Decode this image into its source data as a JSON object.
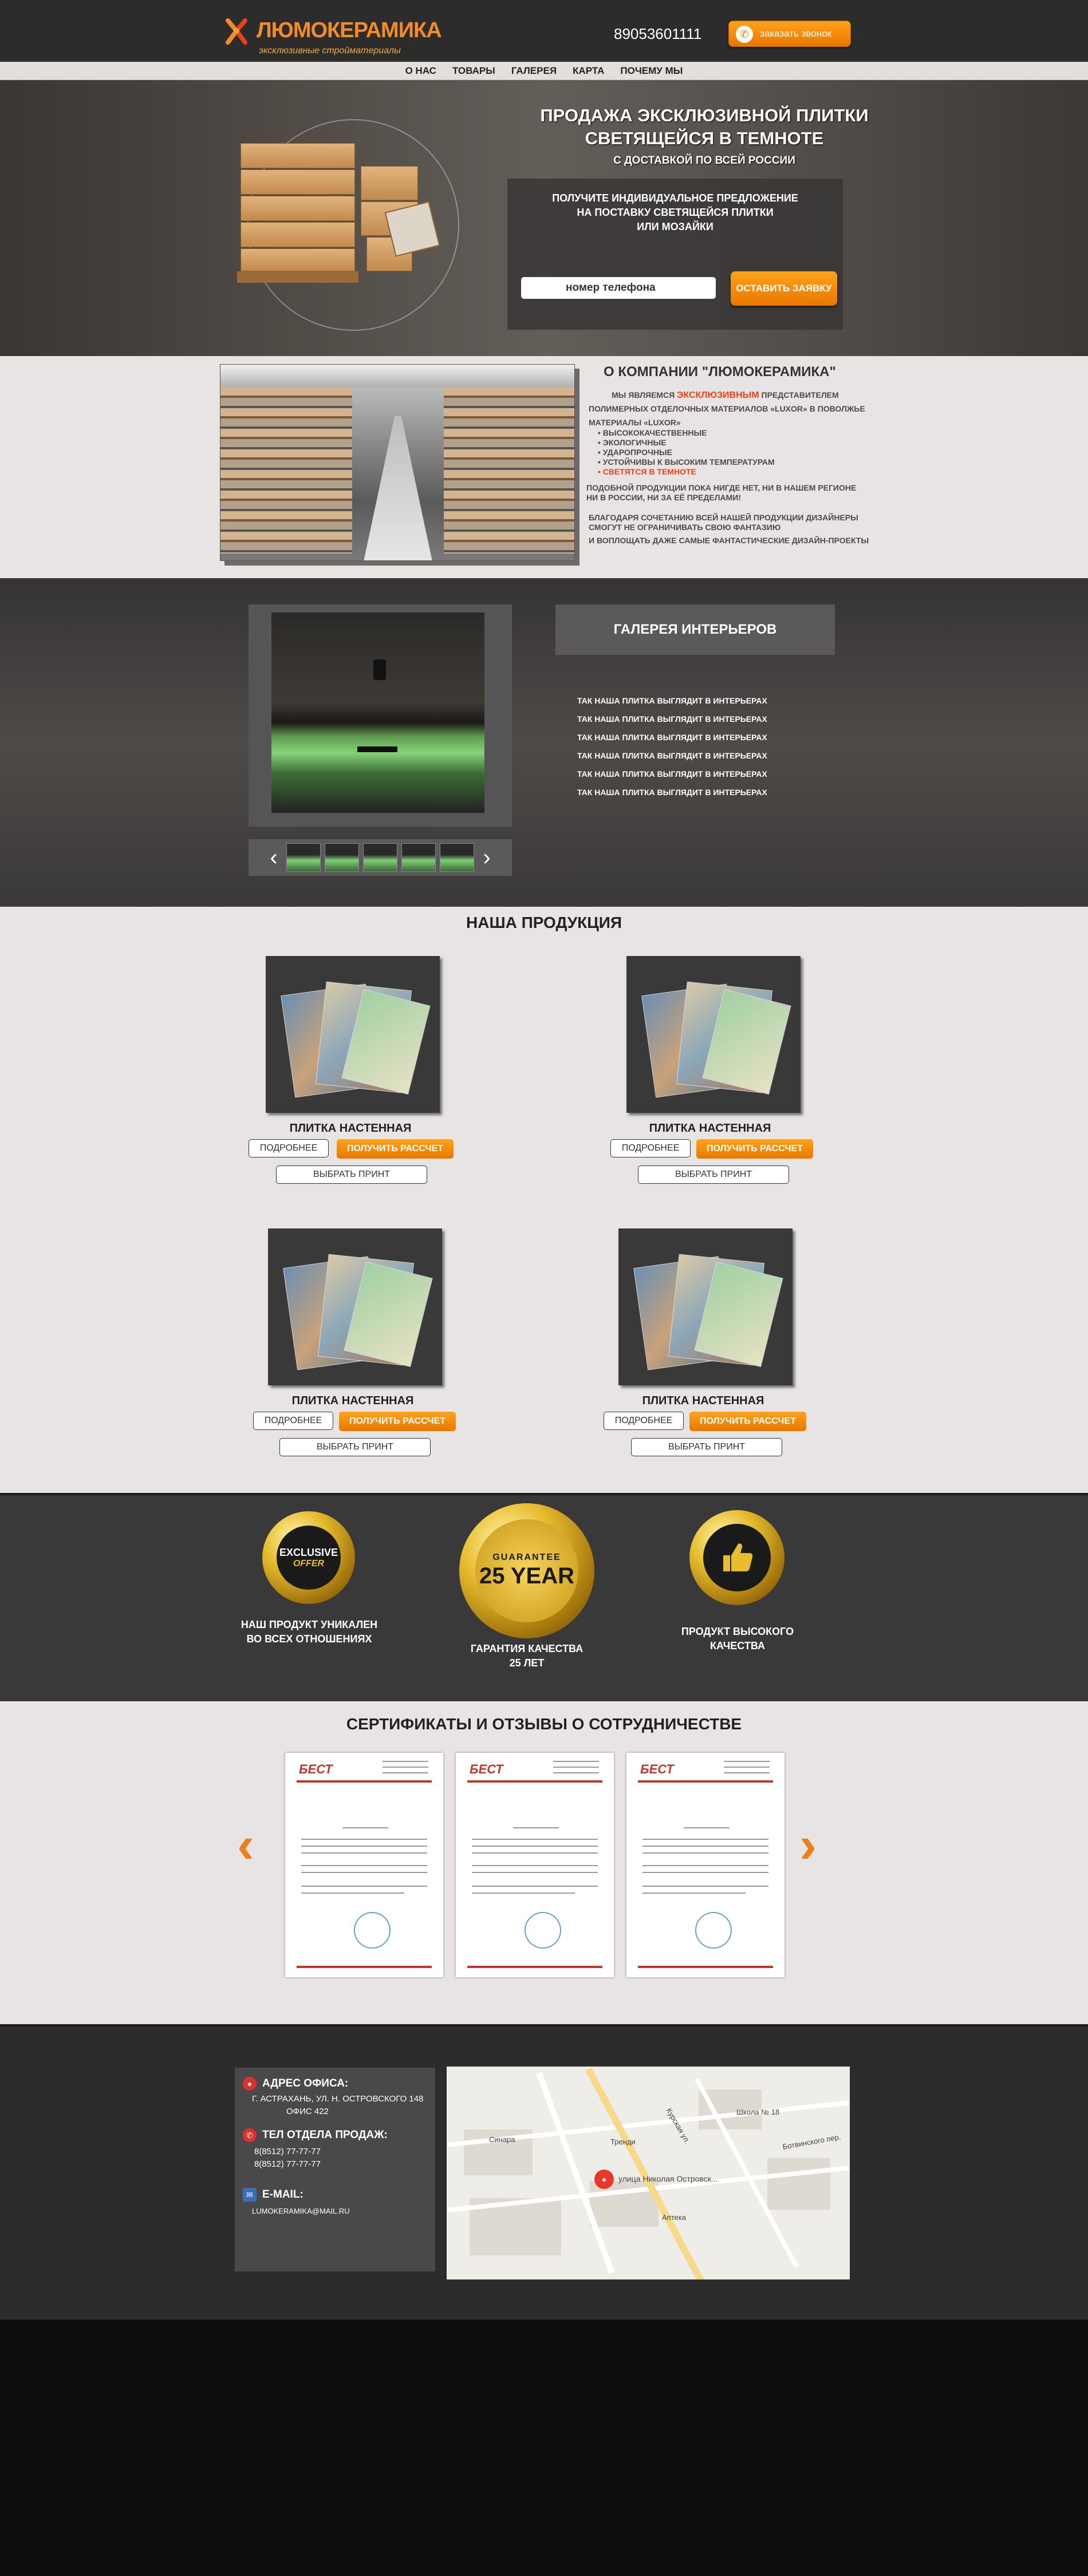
{
  "header": {
    "logo_title": "ЛЮМОКЕРАМИКА",
    "logo_subtitle": "эксклюзивные стройматериалы",
    "phone": "89053601111",
    "callback_label": "заказать звонок"
  },
  "nav": {
    "items": [
      {
        "label": "О НАС"
      },
      {
        "label": "ТОВАРЫ"
      },
      {
        "label": "ГАЛЕРЕЯ"
      },
      {
        "label": "КАРТА"
      },
      {
        "label": "ПОЧЕМУ МЫ"
      }
    ]
  },
  "hero": {
    "title_line1": "ПРОДАЖА ЭКСКЛЮЗИВНОЙ ПЛИТКИ",
    "title_line2": "СВЕТЯЩЕЙСЯ В ТЕМНОТЕ",
    "subtitle": "С ДОСТАВКОЙ ПО ВСЕЙ РОССИИ",
    "offer_line1": "ПОЛУЧИТЕ ИНДИВИДУАЛЬНОЕ ПРЕДЛОЖЕНИЕ",
    "offer_line2": "НА ПОСТАВКУ СВЕТЯЩЕЙСЯ ПЛИТКИ",
    "offer_line3": "ИЛИ МОЗАЙКИ",
    "phone_placeholder": "номер телефона",
    "order_label": "ОСТАВИТЬ ЗАЯВКУ"
  },
  "about": {
    "title": "О КОМПАНИИ \"ЛЮМОКЕРАМИКА\"",
    "intro_before": "МЫ ЯВЛЯЕМСЯ ",
    "intro_highlight": "ЭКСКЛЮЗИВНЫМ",
    "intro_after": " ПРЕДСТАВИТЕЛЕМ",
    "line2": "ПОЛИМЕРНЫХ ОТДЕЛОЧНЫХ МАТЕРИАЛОВ «LUXOR» В ПОВОЛЖЬЕ",
    "materials_head": "МАТЕРИАЛЫ «LUXOR»",
    "features": [
      "• ВЫСОКОКАЧЕСТВЕННЫЕ",
      "• ЭКОЛОГИЧНЫЕ",
      "• УДАРОПРОЧНЫЕ",
      "• УСТОЙЧИВЫ К ВЫСОКИМ ТЕМПЕРАТУРАМ"
    ],
    "feature_highlight": "• СВЕТЯТСЯ В ТЕМНОТЕ",
    "para1_l1": "ПОДОБНОЙ ПРОДУКЦИИ ПОКА НИГДЕ НЕТ, НИ В НАШЕМ РЕГИОНЕ",
    "para1_l2": "НИ В РОССИИ, НИ ЗА ЕЁ ПРЕДЕЛАМИ!",
    "para2_l1": "БЛАГОДАРЯ СОЧЕТАНИЮ ВСЕЙ НАШЕЙ ПРОДУКЦИИ ДИЗАЙНЕРЫ",
    "para2_l2": "СМОГУТ НЕ ОГРАНИЧИВАТЬ СВОЮ ФАНТАЗИЮ",
    "para2_l3": "И ВОПЛОЩАТЬ ДАЖЕ САМЫЕ ФАНТАСТИЧЕСКИЕ ДИЗАЙН-ПРОЕКТЫ"
  },
  "gallery": {
    "title": "ГАЛЕРЕЯ ИНТЕРЬЕРОВ",
    "lines": [
      "ТАК НАША ПЛИТКА ВЫГЛЯДИТ В ИНТЕРЬЕРАХ",
      "ТАК НАША ПЛИТКА ВЫГЛЯДИТ В ИНТЕРЬЕРАХ",
      "ТАК НАША ПЛИТКА ВЫГЛЯДИТ В ИНТЕРЬЕРАХ",
      "ТАК НАША ПЛИТКА ВЫГЛЯДИТ В ИНТЕРЬЕРАХ",
      "ТАК НАША ПЛИТКА ВЫГЛЯДИТ В ИНТЕРЬЕРАХ",
      "ТАК НАША ПЛИТКА ВЫГЛЯДИТ В ИНТЕРЬЕРАХ"
    ],
    "prev_icon": "chevron-left-icon",
    "next_icon": "chevron-right-icon"
  },
  "products": {
    "title": "НАША ПРОДУКЦИЯ",
    "items": [
      {
        "name": "ПЛИТКА НАСТЕННАЯ",
        "details_label": "ПОДРОБНЕЕ",
        "calc_label": "ПОЛУЧИТЬ РАССЧЕТ",
        "print_label": "ВЫБРАТЬ ПРИНТ"
      },
      {
        "name": "ПЛИТКА НАСТЕННАЯ",
        "details_label": "ПОДРОБНЕЕ",
        "calc_label": "ПОЛУЧИТЬ РАССЧЕТ",
        "print_label": "ВЫБРАТЬ ПРИНТ"
      },
      {
        "name": "ПЛИТКА НАСТЕННАЯ",
        "details_label": "ПОДРОБНЕЕ",
        "calc_label": "ПОЛУЧИТЬ РАССЧЕТ",
        "print_label": "ВЫБРАТЬ ПРИНТ"
      },
      {
        "name": "ПЛИТКА НАСТЕННАЯ",
        "details_label": "ПОДРОБНЕЕ",
        "calc_label": "ПОЛУЧИТЬ РАССЧЕТ",
        "print_label": "ВЫБРАТЬ ПРИНТ"
      }
    ]
  },
  "badges": {
    "items": [
      {
        "seal_line1": "EXCLUSIVE",
        "seal_line2": "OFFER",
        "caption_line1": "НАШ ПРОДУКТ УНИКАЛЕН",
        "caption_line2": "ВО ВСЕХ ОТНОШЕНИЯХ"
      },
      {
        "seal_line1": "GUARANTEE",
        "seal_line2": "25 YEAR",
        "caption_line1": "ГАРАНТИЯ КАЧЕСТВА",
        "caption_line2": "25 ЛЕТ"
      },
      {
        "seal_icon": "thumbs-up-icon",
        "caption_line1": "ПРОДУКТ ВЫСОКОГО",
        "caption_line2": "КАЧЕСТВА"
      }
    ]
  },
  "certificates": {
    "title": "СЕРТИФИКАТЫ И ОТЗЫВЫ О СОТРУДНИЧЕСТВЕ",
    "items": [
      {
        "logo": "БЕСТ"
      },
      {
        "logo": "БЕСТ"
      },
      {
        "logo": "БЕСТ"
      }
    ],
    "prev_icon": "chevron-left-icon",
    "next_icon": "chevron-right-icon"
  },
  "contacts": {
    "address_head": "АДРЕС ОФИСА:",
    "address_l1": "Г. АСТРАХАНЬ, УЛ. Н. ОСТРОВСКОГО 148",
    "address_l2": "ОФИС 422",
    "phone_head": "ТЕЛ ОТДЕЛА ПРОДАЖ:",
    "phone_l1": "8(8512) 77-77-77",
    "phone_l2": "8(8512) 77-77-77",
    "email_head": "E-MAIL:",
    "email": "LUMOKERAMIKA@MAIL.RU"
  },
  "map": {
    "labels": {
      "school": "Школа № 18",
      "pin": "улица Николая Островск...",
      "sinara": "Синара",
      "store": "Тренди",
      "pharmacy": "Аптека",
      "street1": "Курская ул.",
      "street2": "Ботвинского пер."
    },
    "colors": {
      "pin": "#e8382a",
      "roads": "#ffffff",
      "main_road": "#f7d98a"
    }
  },
  "colors": {
    "accent": "#f28c28",
    "button_orange": "#ff9a1a",
    "dark_bg": "#2d2c2c",
    "light_bg": "#e8e4e3",
    "highlight_red": "#e8421a"
  }
}
